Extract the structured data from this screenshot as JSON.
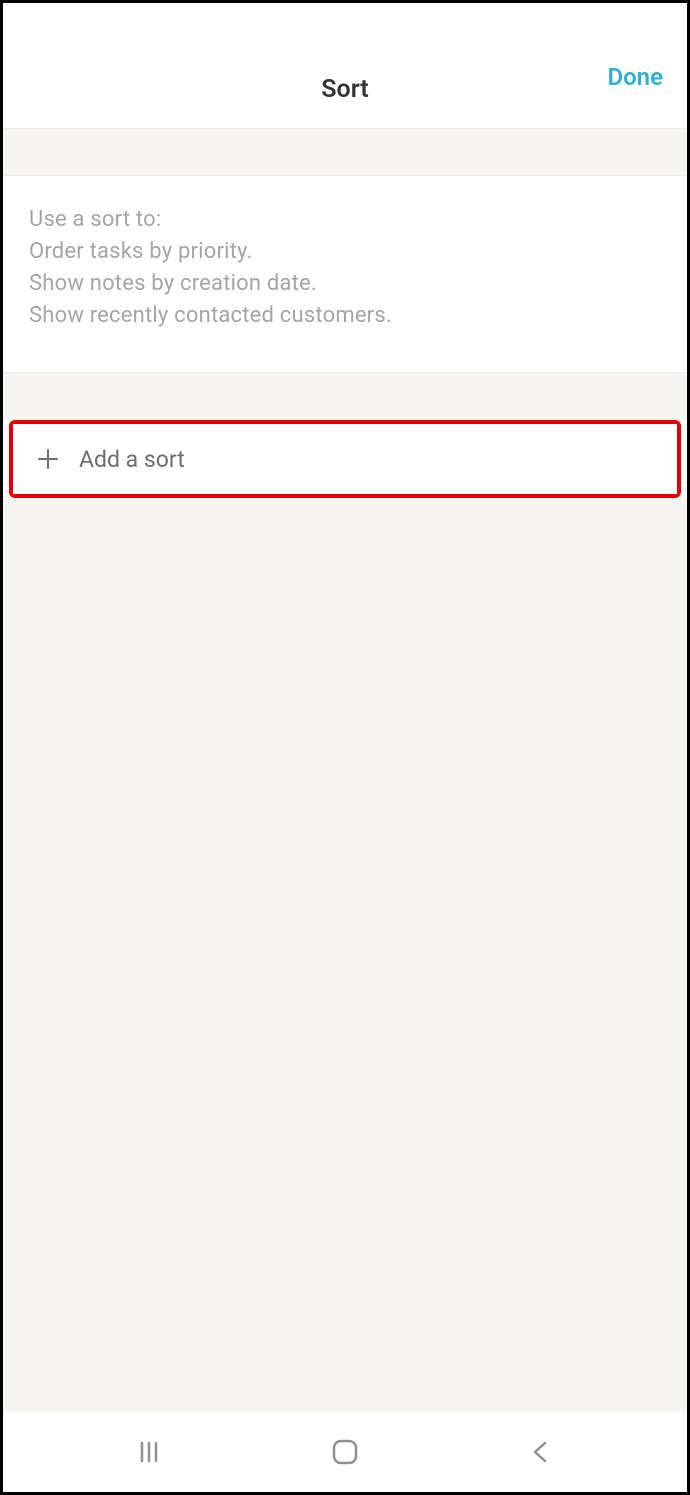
{
  "header": {
    "title": "Sort",
    "done_label": "Done"
  },
  "description": {
    "line1": "Use a sort to:",
    "line2": "Order tasks by priority.",
    "line3": "Show notes by creation date.",
    "line4": "Show recently contacted customers."
  },
  "add_sort": {
    "label": "Add a sort"
  },
  "colors": {
    "accent": "#30afd6",
    "highlight_border": "#e30000",
    "background_muted": "#f6f5f2",
    "text_muted": "#a5a5a5"
  }
}
